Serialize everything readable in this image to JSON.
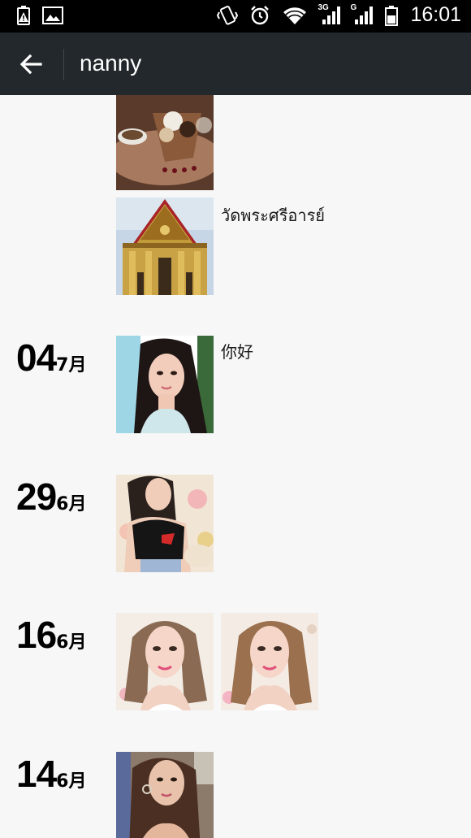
{
  "status_bar": {
    "time": "16:01",
    "network_1": "3G",
    "network_2": "G",
    "icons": [
      "battery-warning-icon",
      "gallery-icon",
      "vibrate-icon",
      "alarm-icon",
      "wifi-icon",
      "signal-3g-icon",
      "signal-g-icon",
      "battery-icon"
    ]
  },
  "header": {
    "title": "nanny",
    "back_icon": "arrow-left-icon"
  },
  "timeline": [
    {
      "date_day": "",
      "date_month": "",
      "photos": [
        "dessert-photo"
      ],
      "caption": ""
    },
    {
      "date_day": "",
      "date_month": "",
      "photos": [
        "temple-photo"
      ],
      "caption": "วัดพระศรีอารย์"
    },
    {
      "date_day": "04",
      "date_month": "7月",
      "photos": [
        "selfie-photo"
      ],
      "caption": "你好"
    },
    {
      "date_day": "29",
      "date_month": "6月",
      "photos": [
        "selfie-photo"
      ],
      "caption": ""
    },
    {
      "date_day": "16",
      "date_month": "6月",
      "photos": [
        "selfie-photo",
        "selfie-photo"
      ],
      "caption": ""
    },
    {
      "date_day": "14",
      "date_month": "6月",
      "photos": [
        "selfie-photo"
      ],
      "caption": ""
    }
  ]
}
